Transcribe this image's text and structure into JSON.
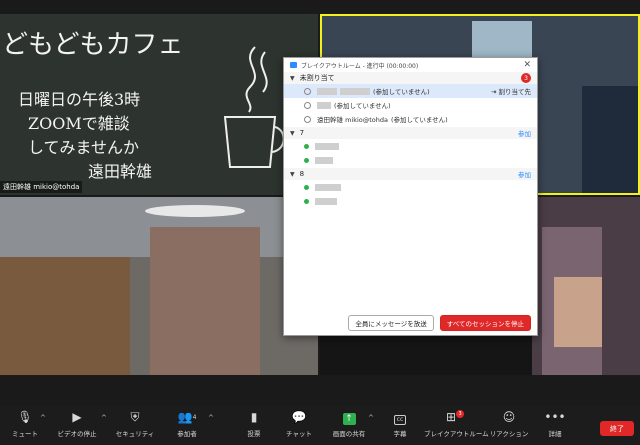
{
  "tiles": {
    "top_left_name": "遠田幹雄 mikio@tohda",
    "chalk_lines": [
      "どもどもカフェ",
      "日曜日の午後3時",
      "ZOOMで雑談",
      "してみませんか",
      "遠田幹雄"
    ]
  },
  "dialog": {
    "title": "ブレイクアウトルーム - 進行中 (00:00:00)",
    "unassigned": {
      "label": "未割り当て",
      "count": "3",
      "rows": [
        {
          "status": "(参加していません)",
          "action": "割り当て先"
        },
        {
          "status": "(参加していません)"
        },
        {
          "name": "遠田幹雄 mikio@tohda",
          "status": "(参加していません)"
        }
      ]
    },
    "rooms": [
      {
        "label": "7",
        "action": "参加"
      },
      {
        "label": "8",
        "action": "参加"
      }
    ],
    "buttons": {
      "message_all": "全員にメッセージを放送",
      "close_all": "すべてのセッションを停止"
    }
  },
  "toolbar": {
    "mute": "ミュート",
    "video": "ビデオの停止",
    "security": "セキュリティ",
    "participants": "参加者",
    "participants_count": "4",
    "polls": "投票",
    "chat": "チャット",
    "share": "画面の共有",
    "captions": "字幕",
    "breakout": "ブレイクアウトルーム",
    "breakout_badge": "3",
    "reactions": "リアクション",
    "more": "詳細",
    "end": "終了"
  },
  "colors": {
    "accent": "#2d8cff",
    "danger": "#e02828",
    "toolbar_bg": "#1c1c1c",
    "active_speaker": "#f4f01e"
  }
}
